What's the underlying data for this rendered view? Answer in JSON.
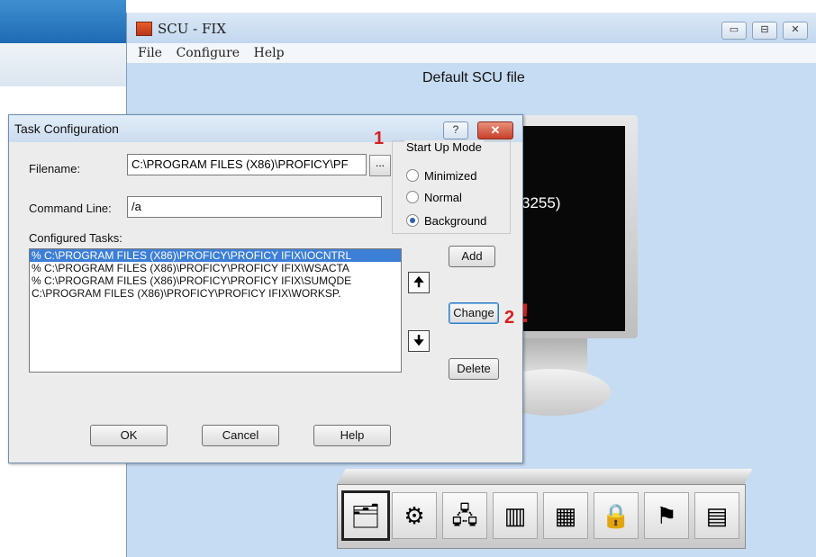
{
  "main_window": {
    "title": "SCU - FIX",
    "menu": [
      "File",
      "Configure",
      "Help"
    ],
    "file_label": "Default SCU file",
    "monitor_text": "3255)",
    "window_buttons": [
      "▭",
      "⊟",
      "✕"
    ]
  },
  "dialog": {
    "title": "Task Configuration",
    "help_button": "?",
    "close_button": "✕",
    "filename_label": "Filename:",
    "filename_value": "C:\\PROGRAM FILES (X86)\\PROFICY\\PF",
    "browse_button": "...",
    "command_line_label": "Command Line:",
    "command_line_value": "/a",
    "startup_mode": {
      "title": "Start Up Mode",
      "options": [
        "Minimized",
        "Normal",
        "Background"
      ],
      "selected": "Background"
    },
    "configured_tasks_label": "Configured Tasks:",
    "tasks": [
      "% C:\\PROGRAM FILES (X86)\\PROFICY\\PROFICY IFIX\\IOCNTRL",
      "% C:\\PROGRAM FILES (X86)\\PROFICY\\PROFICY IFIX\\WSACTA",
      "% C:\\PROGRAM FILES (X86)\\PROFICY\\PROFICY IFIX\\SUMQDE",
      "  C:\\PROGRAM FILES (X86)\\PROFICY\\PROFICY IFIX\\WORKSP."
    ],
    "selected_task_index": 0,
    "buttons": {
      "add": "Add",
      "change": "Change",
      "delete": "Delete",
      "up": "🠉",
      "down": "🠋",
      "ok": "OK",
      "cancel": "Cancel",
      "help": "Help"
    }
  },
  "annotations": {
    "one": "1",
    "two": "2",
    "exclamation": "!"
  },
  "toolbar": {
    "icons": [
      "tasks-icon",
      "alarms-icon",
      "network-icon",
      "sql-icon",
      "scada-icon",
      "security-icon",
      "auto-startup-icon",
      "paths-icon"
    ],
    "glyphs": [
      "🗂",
      "⚙",
      "🖧",
      "▥",
      "▦",
      "🔒",
      "⚑",
      "▤"
    ],
    "active_index": 0
  },
  "colors": {
    "accent": "#3d7fd6",
    "annotation": "#d81e1e",
    "scu_background": "#c6dcf2"
  }
}
